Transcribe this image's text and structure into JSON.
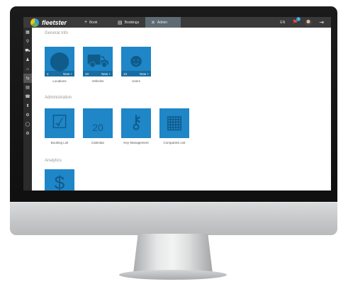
{
  "app": {
    "name": "fleetster"
  },
  "topbar": {
    "nav": [
      {
        "label": "Book",
        "icon": "+"
      },
      {
        "label": "Bookings",
        "icon": "▤"
      },
      {
        "label": "Admin",
        "icon": "✕"
      }
    ],
    "language": "EN",
    "notification_count": "1"
  },
  "sidebar": {
    "items": [
      "▦",
      "⚲",
      "⛟",
      "♟",
      "⌂",
      "⇆",
      "▤",
      "☎",
      "⬆",
      "⚙",
      "◯",
      "⚙"
    ]
  },
  "sections": {
    "general_info": {
      "title": "General Info",
      "tiles": [
        {
          "label": "Locations",
          "count": "2",
          "action": "New +",
          "icon": "location-pin-icon"
        },
        {
          "label": "Vehicles",
          "count": "10",
          "action": "New +",
          "icon": "car-icon"
        },
        {
          "label": "Users",
          "count": "13",
          "action": "New +",
          "icon": "user-icon"
        }
      ]
    },
    "administration": {
      "title": "Administration",
      "tiles": [
        {
          "label": "Booking List",
          "icon": "checklist-icon"
        },
        {
          "label": "Calendar",
          "icon": "calendar-icon"
        },
        {
          "label": "Key Management",
          "icon": "key-icon"
        },
        {
          "label": "Companies List",
          "icon": "building-icon"
        }
      ],
      "calendar_day": "20"
    },
    "analytics": {
      "title": "Analytics",
      "tiles": [
        {
          "icon": "money-icon"
        }
      ]
    }
  }
}
